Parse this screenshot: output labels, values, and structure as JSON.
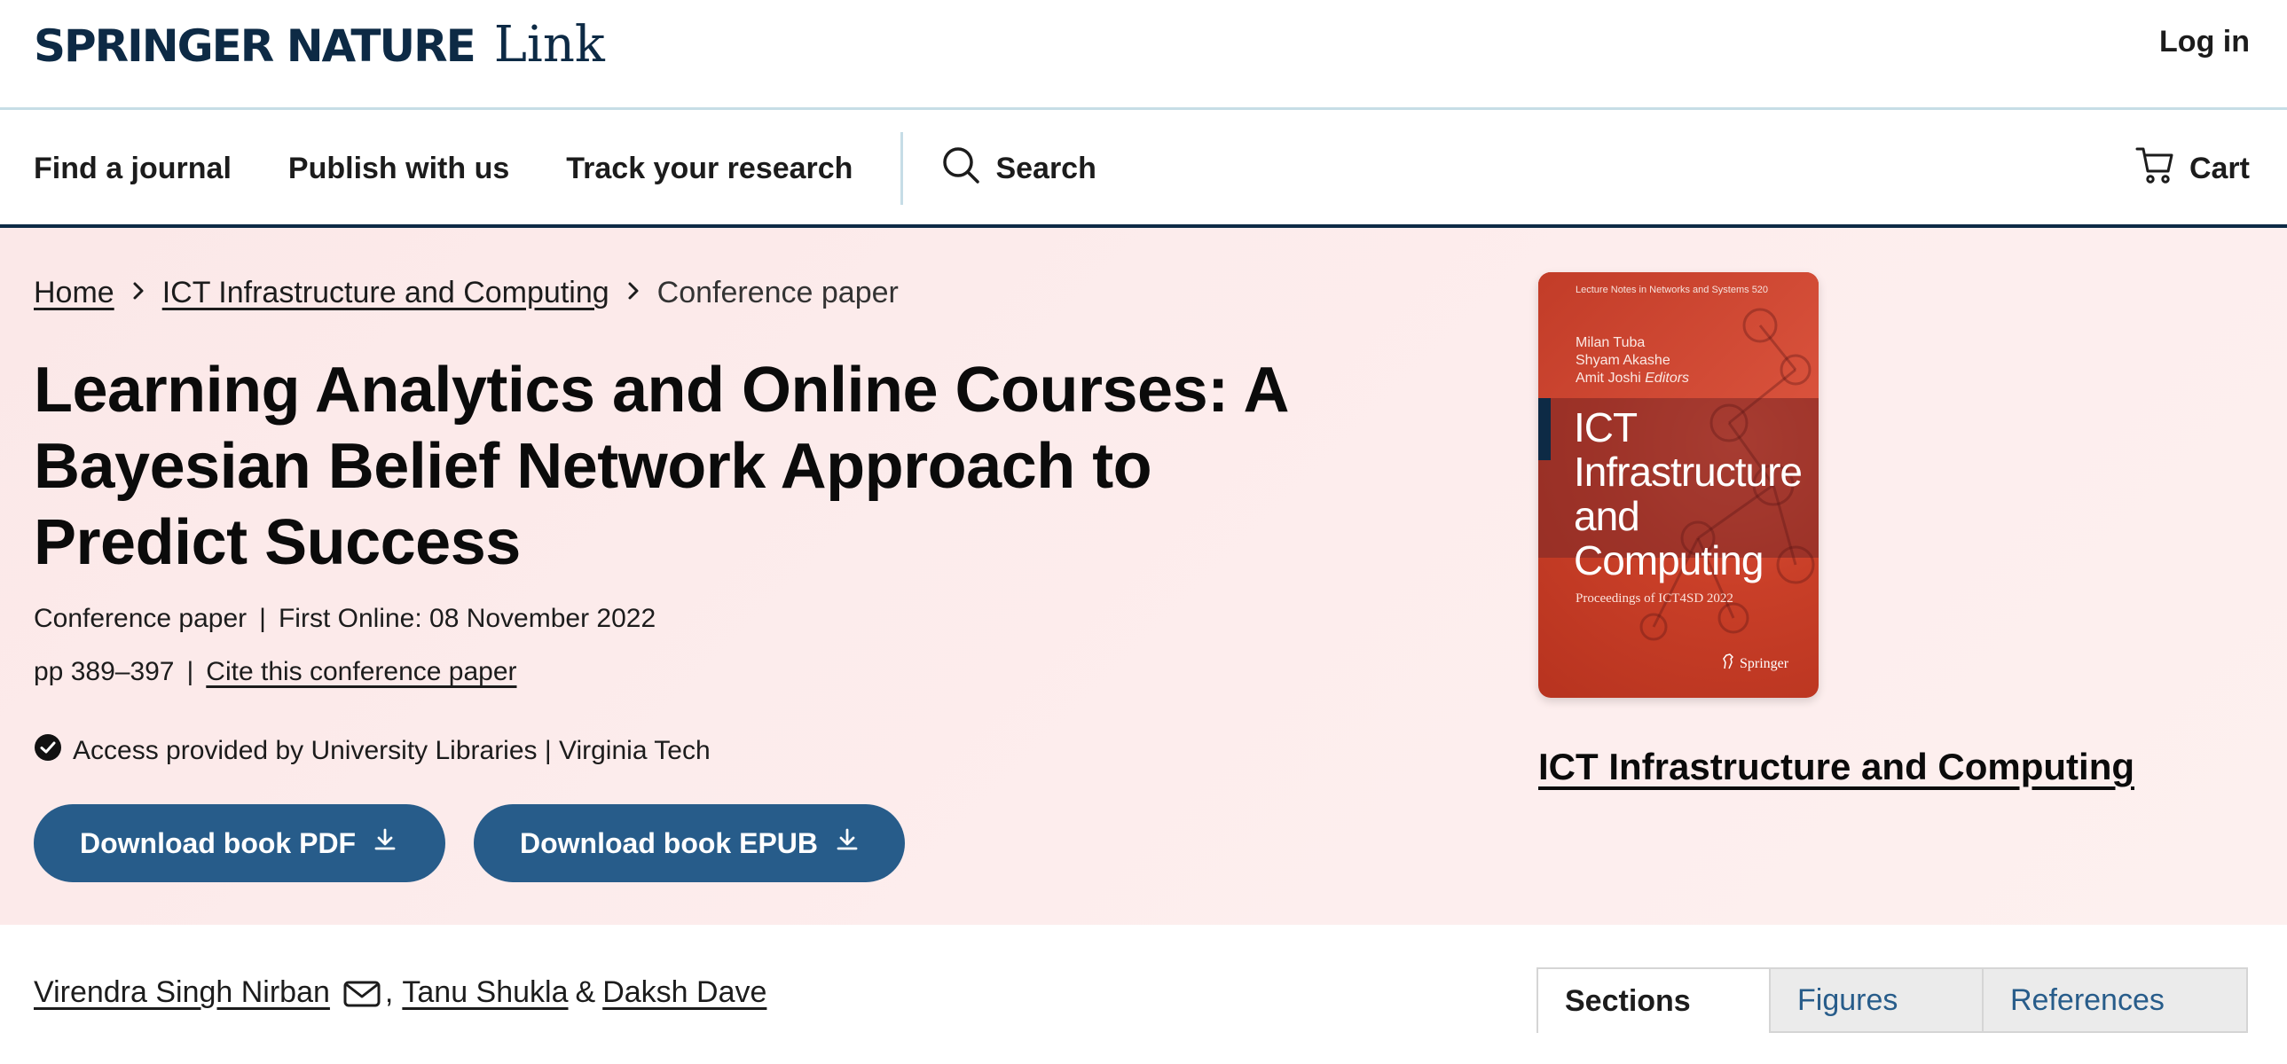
{
  "header": {
    "logo_brand": "SPRINGER NATURE",
    "logo_product": "Link",
    "login_label": "Log in"
  },
  "nav": {
    "items": [
      "Find a journal",
      "Publish with us",
      "Track your research"
    ],
    "search_label": "Search",
    "cart_label": "Cart"
  },
  "breadcrumb": {
    "home": "Home",
    "book": "ICT Infrastructure and Computing",
    "current": "Conference paper"
  },
  "article": {
    "title": "Learning Analytics and Online Courses: A Bayesian Belief Network Approach to Predict Success",
    "type": "Conference paper",
    "first_online": "First Online: 08 November 2022",
    "pages": "pp 389–397",
    "cite_label": "Cite this conference paper",
    "access_text": "Access provided by University Libraries | Virginia Tech",
    "download_pdf": "Download book PDF",
    "download_epub": "Download book EPUB"
  },
  "book": {
    "series": "Lecture Notes in Networks and Systems 520",
    "editors": [
      "Milan Tuba",
      "Shyam Akashe",
      "Amit Joshi"
    ],
    "editors_suffix": "Editors",
    "cover_title_lines": [
      "ICT",
      "Infrastructure",
      "and",
      "Computing"
    ],
    "cover_subtitle": "Proceedings of ICT4SD 2022",
    "publisher": "Springer",
    "title_link": "ICT Infrastructure and Computing"
  },
  "authors": {
    "names": [
      "Virendra Singh Nirban",
      "Tanu Shukla",
      "Daksh Dave"
    ],
    "sep_comma": ",",
    "sep_amp": "&"
  },
  "tabs": [
    "Sections",
    "Figures",
    "References"
  ],
  "colors": {
    "brand_navy": "#0d2a45",
    "button_blue": "#275c8a",
    "hero_bg": "#fbe8e8",
    "tab_link": "#275c8a"
  }
}
